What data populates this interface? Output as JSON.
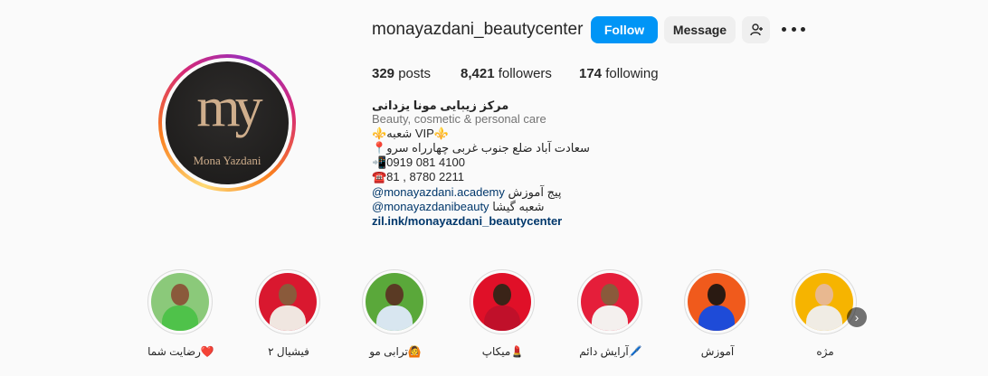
{
  "profile": {
    "username": "monayazdani_beautycenter",
    "logo_mark": "my",
    "logo_text": "Mona Yazdani",
    "follow_label": "Follow",
    "message_label": "Message",
    "stats": {
      "posts_count": "329",
      "posts_label": "posts",
      "followers_count": "8,421",
      "followers_label": "followers",
      "following_count": "174",
      "following_label": "following"
    },
    "full_name": "مرکز زیبایی مونا یزدانی",
    "category": "Beauty, cosmetic & personal care",
    "bio": {
      "line1": "⚜️شعبه VIP⚜️",
      "line2": "📍سعادت آباد ضلع جنوب غربی چهارراه سرو",
      "line3": "📲0919 081 4100",
      "line4": "☎️81 , 8780 2211",
      "line5_link": "@monayazdani.academy",
      "line5_text": " پیج آموزش",
      "line6_link": "@monayazdanibeauty",
      "line6_text": " شعبه گیشا"
    },
    "link": "zil.ink/monayazdani_beautycenter"
  },
  "highlights": [
    {
      "label": "رضایت شما❤️",
      "bg": "#8bc97a"
    },
    {
      "label": "فیشیال ۲",
      "bg": "#d9182f"
    },
    {
      "label": "ترابی مو🙆",
      "bg": "#5aa83a"
    },
    {
      "label": "میکاپ💄",
      "bg": "#e01028"
    },
    {
      "label": "آرایش دائم🖊️",
      "bg": "#e51e3a"
    },
    {
      "label": "آموزش",
      "bg": "#f05a1c"
    },
    {
      "label": "مژه",
      "bg": "#f6b400"
    }
  ],
  "colors": {
    "accent": "#0095f6",
    "link": "#00376b",
    "secondary_text": "#737373"
  }
}
